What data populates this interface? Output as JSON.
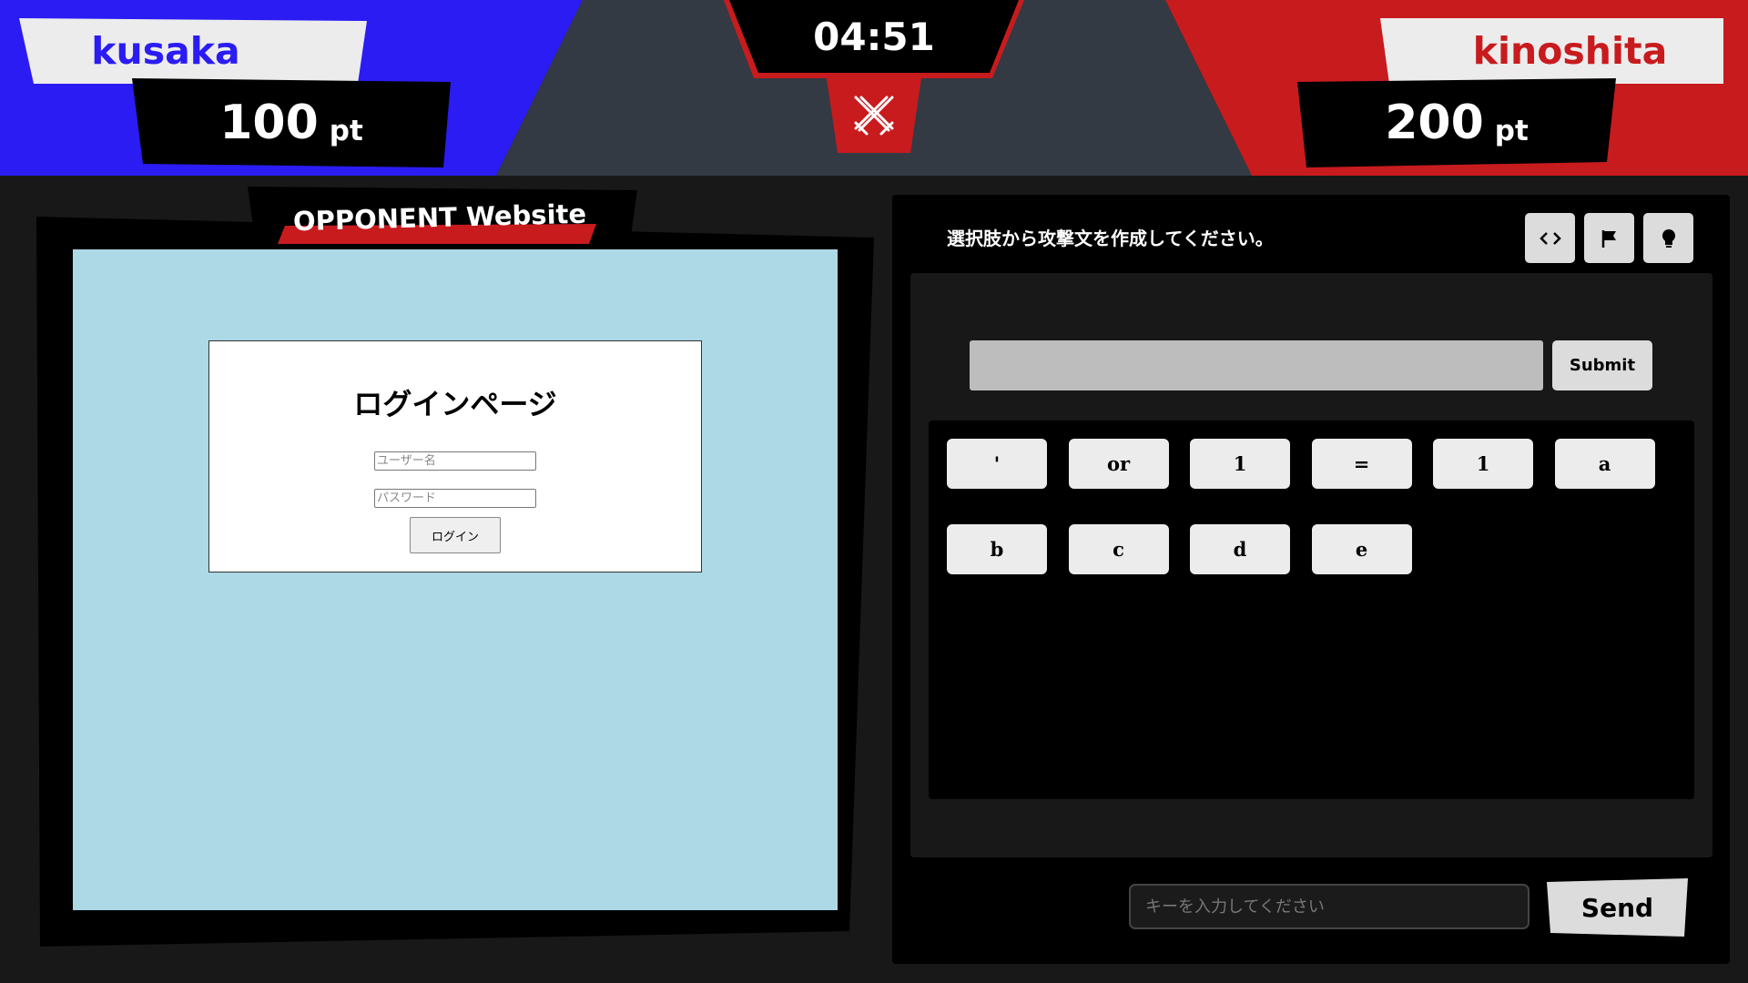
{
  "players": {
    "left": {
      "name": "kusaka",
      "score": "100",
      "unit": "pt",
      "color": "#2a1cf2"
    },
    "right": {
      "name": "kinoshita",
      "score": "200",
      "unit": "pt",
      "color": "#c81b1e"
    }
  },
  "timer": "04:51",
  "vs_icon": "crossed-swords-icon",
  "opponent_panel": {
    "title": "OPPONENT Website",
    "site_background": "#add8e6",
    "login": {
      "title": "ログインページ",
      "username_placeholder": "ユーザー名",
      "password_placeholder": "パスワード",
      "button": "ログイン"
    }
  },
  "attack_panel": {
    "instruction": "選択肢から攻撃文を作成してください。",
    "tools": [
      "code-icon",
      "flag-icon",
      "lightbulb-icon"
    ],
    "submit": "Submit",
    "choices": [
      "'",
      "or",
      "1",
      "=",
      "1",
      "a",
      "b",
      "c",
      "d",
      "e"
    ],
    "key_placeholder": "キーを入力してください",
    "send": "Send"
  }
}
